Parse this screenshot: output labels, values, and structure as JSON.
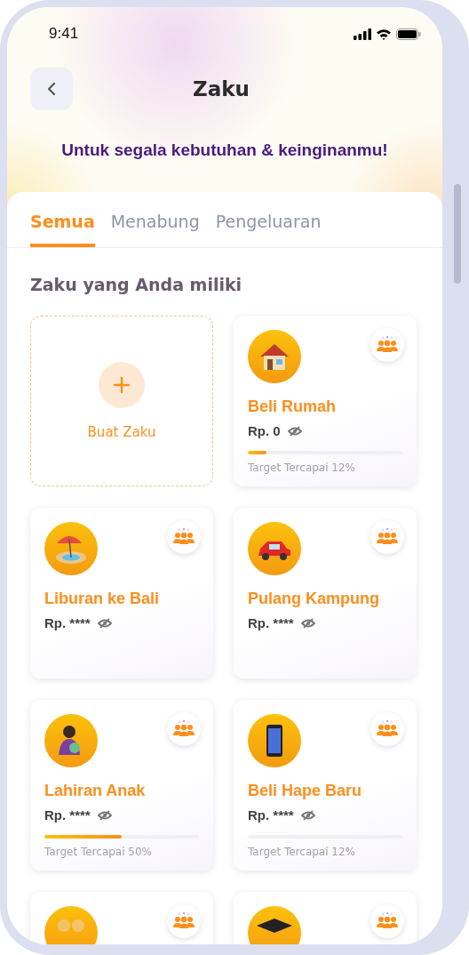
{
  "status_bar": {
    "time": "9:41"
  },
  "header": {
    "title": "Zaku",
    "subtitle": "Untuk segala kebutuhan & keinginanmu!"
  },
  "tabs": [
    {
      "label": "Semua",
      "selected": true
    },
    {
      "label": "Menabung",
      "selected": false
    },
    {
      "label": "Pengeluaran",
      "selected": false
    }
  ],
  "section_title": "Zaku yang Anda miliki",
  "create_card": {
    "label": "Buat Zaku"
  },
  "cards": [
    {
      "kind": "house",
      "name": "Beli Rumah",
      "amount": "Rp. 0",
      "progress": {
        "level": 0.12,
        "label": "Target Tercapai 12%"
      }
    },
    {
      "kind": "beach",
      "name": "Liburan ke Bali",
      "amount": "Rp. ****"
    },
    {
      "kind": "car",
      "name": "Pulang Kampung",
      "amount": "Rp. ****"
    },
    {
      "kind": "baby",
      "name": "Lahiran Anak",
      "amount": "Rp. ****",
      "progress": {
        "level": 0.5,
        "label": "Target Tercapai 50%"
      }
    },
    {
      "kind": "phone",
      "name": "Beli Hape Baru",
      "amount": "Rp. ****",
      "progress": {
        "level": 0,
        "label": "Target Tercapai 12%"
      }
    },
    {
      "kind": "couple"
    },
    {
      "kind": "graduation"
    }
  ]
}
